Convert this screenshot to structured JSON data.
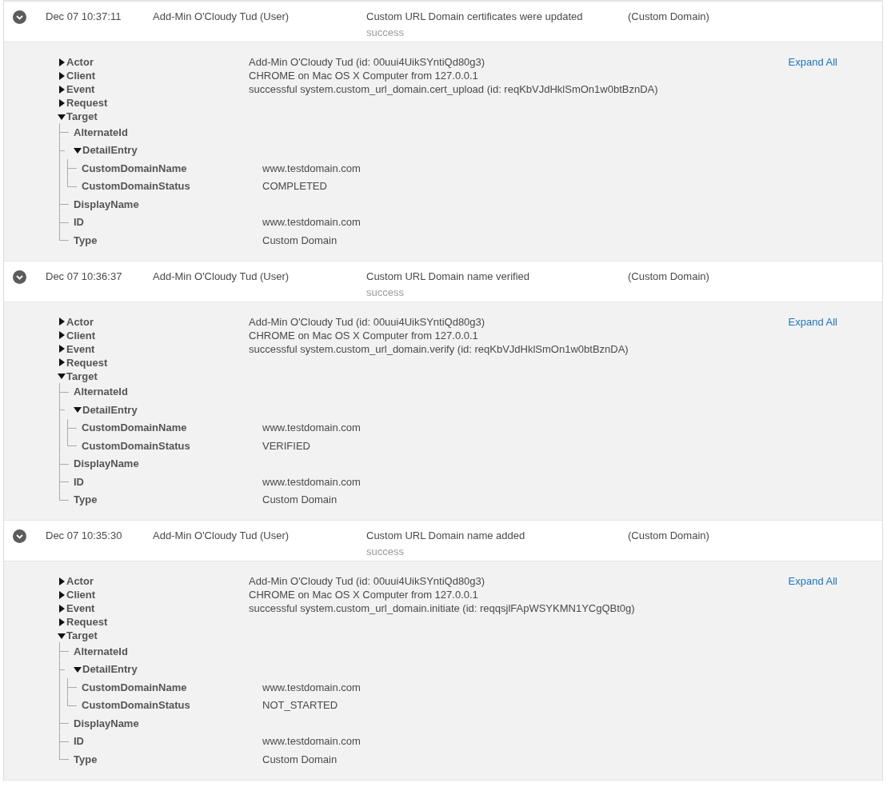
{
  "entries": [
    {
      "expanded": true,
      "time": "Dec 07 10:37:11",
      "actor": "Add-Min O'Cloudy Tud  (User)",
      "event": "Custom URL Domain certificates were updated",
      "outcome": "success",
      "target": "(Custom Domain)",
      "expand_all": "Expand All",
      "details": [
        {
          "label": "Actor",
          "value": "Add-Min O'Cloudy Tud (id: 00uui4UikSYntiQd80g3)",
          "expanded": false
        },
        {
          "label": "Client",
          "value": "CHROME on Mac OS X Computer from 127.0.0.1",
          "expanded": false
        },
        {
          "label": "Event",
          "value": "successful system.custom_url_domain.cert_upload (id: reqKbVJdHklSmOn1w0btBznDA)",
          "expanded": false
        },
        {
          "label": "Request",
          "expanded": false
        },
        {
          "label": "Target",
          "expanded": true,
          "children": [
            {
              "label": "AlternateId"
            },
            {
              "label": "DetailEntry",
              "expanded": true,
              "children": [
                {
                  "label": "CustomDomainName",
                  "value": "www.testdomain.com"
                },
                {
                  "label": "CustomDomainStatus",
                  "value": "COMPLETED"
                }
              ]
            },
            {
              "label": "DisplayName"
            },
            {
              "label": "ID",
              "value": "www.testdomain.com"
            },
            {
              "label": "Type",
              "value": "Custom Domain"
            }
          ]
        }
      ]
    },
    {
      "expanded": true,
      "time": "Dec 07 10:36:37",
      "actor": "Add-Min O'Cloudy Tud  (User)",
      "event": "Custom URL Domain name verified",
      "outcome": "success",
      "target": "(Custom Domain)",
      "expand_all": "Expand All",
      "details": [
        {
          "label": "Actor",
          "value": "Add-Min O'Cloudy Tud (id: 00uui4UikSYntiQd80g3)",
          "expanded": false
        },
        {
          "label": "Client",
          "value": "CHROME on Mac OS X Computer from 127.0.0.1",
          "expanded": false
        },
        {
          "label": "Event",
          "value": "successful system.custom_url_domain.verify (id: reqKbVJdHklSmOn1w0btBznDA)",
          "expanded": false
        },
        {
          "label": "Request",
          "expanded": false
        },
        {
          "label": "Target",
          "expanded": true,
          "children": [
            {
              "label": "AlternateId"
            },
            {
              "label": "DetailEntry",
              "expanded": true,
              "children": [
                {
                  "label": "CustomDomainName",
                  "value": "www.testdomain.com"
                },
                {
                  "label": "CustomDomainStatus",
                  "value": "VERIFIED"
                }
              ]
            },
            {
              "label": "DisplayName"
            },
            {
              "label": "ID",
              "value": "www.testdomain.com"
            },
            {
              "label": "Type",
              "value": "Custom Domain"
            }
          ]
        }
      ]
    },
    {
      "expanded": true,
      "time": "Dec 07 10:35:30",
      "actor": "Add-Min O'Cloudy Tud  (User)",
      "event": "Custom URL Domain name added",
      "outcome": "success",
      "target": "(Custom Domain)",
      "expand_all": "Expand All",
      "details": [
        {
          "label": "Actor",
          "value": "Add-Min O'Cloudy Tud (id: 00uui4UikSYntiQd80g3)",
          "expanded": false
        },
        {
          "label": "Client",
          "value": "CHROME on Mac OS X Computer from 127.0.0.1",
          "expanded": false
        },
        {
          "label": "Event",
          "value": "successful system.custom_url_domain.initiate (id: reqqsjlFApWSYKMN1YCgQBt0g)",
          "expanded": false
        },
        {
          "label": "Request",
          "expanded": false
        },
        {
          "label": "Target",
          "expanded": true,
          "children": [
            {
              "label": "AlternateId"
            },
            {
              "label": "DetailEntry",
              "expanded": true,
              "children": [
                {
                  "label": "CustomDomainName",
                  "value": "www.testdomain.com"
                },
                {
                  "label": "CustomDomainStatus",
                  "value": "NOT_STARTED"
                }
              ]
            },
            {
              "label": "DisplayName"
            },
            {
              "label": "ID",
              "value": "www.testdomain.com"
            },
            {
              "label": "Type",
              "value": "Custom Domain"
            }
          ]
        }
      ]
    }
  ]
}
